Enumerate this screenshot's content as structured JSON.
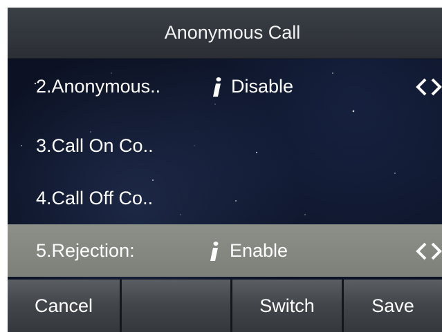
{
  "title": "Anonymous Call",
  "rows": [
    {
      "label": "2.Anonymous..",
      "value": "Disable",
      "has_info": true,
      "has_arrows": true,
      "selected": false
    },
    {
      "label": "3.Call On Co..",
      "value": "",
      "has_info": false,
      "has_arrows": false,
      "selected": false
    },
    {
      "label": "4.Call Off Co..",
      "value": "",
      "has_info": false,
      "has_arrows": false,
      "selected": false
    },
    {
      "label": "5.Rejection:",
      "value": "Enable",
      "has_info": true,
      "has_arrows": true,
      "selected": true
    }
  ],
  "softkeys": {
    "cancel": "Cancel",
    "blank": "",
    "switch": "Switch",
    "save": "Save"
  },
  "icons": {
    "info": "info-icon",
    "arrows": "left-right-arrows-icon"
  },
  "colors": {
    "title_bar": "#34383e",
    "selected_row": "#868982",
    "background": "#0c1224",
    "text": "#ffffff"
  }
}
